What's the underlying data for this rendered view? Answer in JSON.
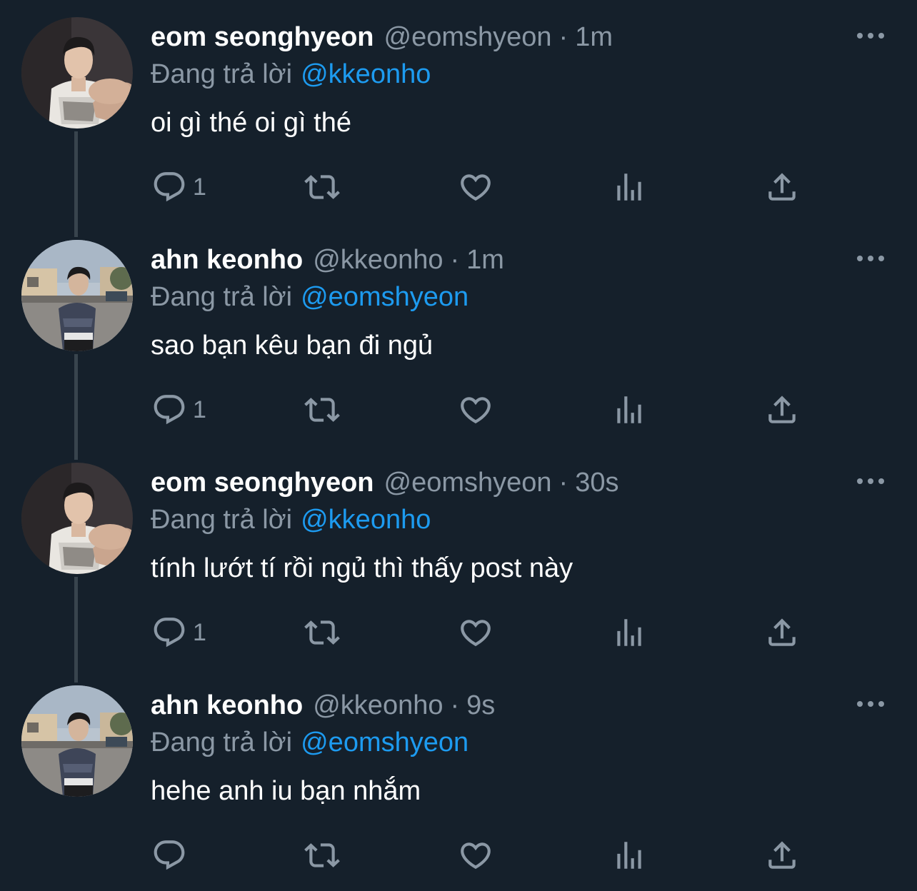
{
  "tweets": [
    {
      "name": "eom seonghyeon",
      "handle": "@eomshyeon",
      "separator": "·",
      "time": "1m",
      "reply_prefix": "Đang trả lời",
      "reply_to": "@kkeonho",
      "text": "oi gì thé oi gì thé",
      "reply_count": "1",
      "avatar": "avatar-eomshyeon"
    },
    {
      "name": "ahn keonho",
      "handle": "@kkeonho",
      "separator": "·",
      "time": "1m",
      "reply_prefix": "Đang trả lời",
      "reply_to": "@eomshyeon",
      "text": "sao bạn kêu bạn đi ngủ",
      "reply_count": "1",
      "avatar": "avatar-kkeonho"
    },
    {
      "name": "eom seonghyeon",
      "handle": "@eomshyeon",
      "separator": "·",
      "time": "30s",
      "reply_prefix": "Đang trả lời",
      "reply_to": "@kkeonho",
      "text": "tính lướt tí rồi ngủ thì thấy post này",
      "reply_count": "1",
      "avatar": "avatar-eomshyeon"
    },
    {
      "name": "ahn keonho",
      "handle": "@kkeonho",
      "separator": "·",
      "time": "9s",
      "reply_prefix": "Đang trả lời",
      "reply_to": "@eomshyeon",
      "text": "hehe anh iu bạn nhắm",
      "reply_count": "",
      "avatar": "avatar-kkeonho"
    }
  ],
  "icons": {
    "reply": "reply-icon",
    "retweet": "retweet-icon",
    "like": "heart-icon",
    "stats": "stats-icon",
    "share": "share-icon",
    "more": "more-icon"
  },
  "colors": {
    "background": "#15202b",
    "secondary_text": "#8b98a5",
    "mention": "#1d9bf0",
    "thread_line": "#38444d"
  }
}
